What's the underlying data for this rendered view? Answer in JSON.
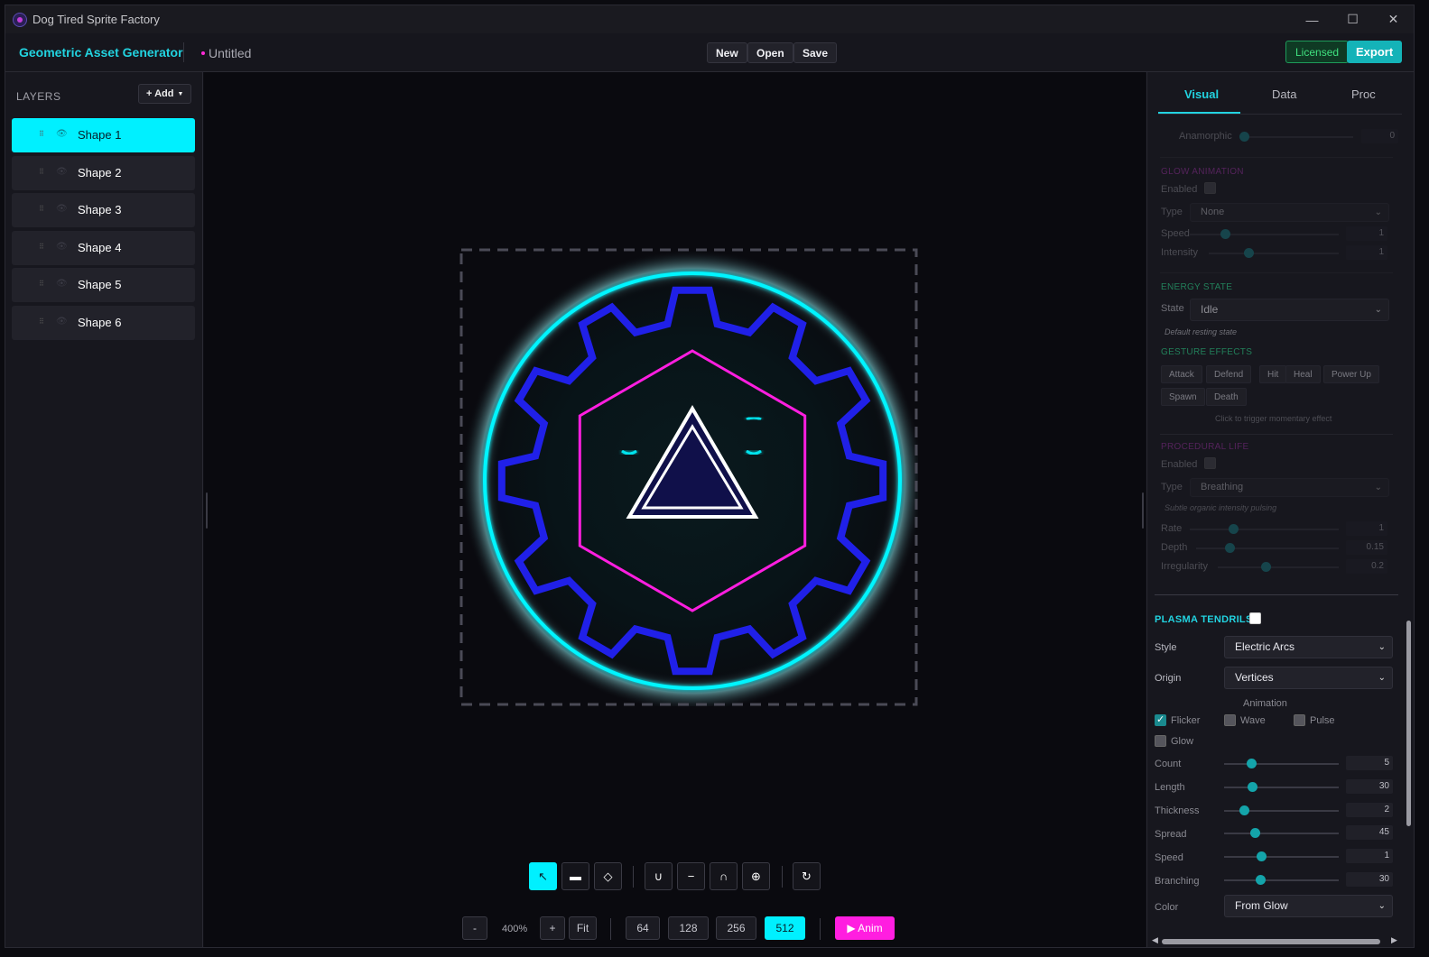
{
  "window": {
    "title": "Dog Tired Sprite Factory"
  },
  "header": {
    "brand": "Geometric Asset Generator",
    "doc_name": "Untitled",
    "new_label": "New",
    "open_label": "Open",
    "save_label": "Save",
    "licensed_label": "Licensed",
    "export_label": "Export"
  },
  "layers": {
    "title": "LAYERS",
    "add_label": "+ Add",
    "items": [
      {
        "label": "Shape 1",
        "active": true
      },
      {
        "label": "Shape 2"
      },
      {
        "label": "Shape 3"
      },
      {
        "label": "Shape 4"
      },
      {
        "label": "Shape 5"
      },
      {
        "label": "Shape 6"
      }
    ]
  },
  "canvas": {
    "colors": {
      "ring": "#00f5ff",
      "gear": "#2020e8",
      "hex": "#ff1ee0",
      "triangle_fill": "#10104a"
    },
    "zoom_minus": "-",
    "zoom_value": "400%",
    "zoom_plus": "+",
    "fit_label": "Fit",
    "sizes": [
      "64",
      "128",
      "256",
      "512"
    ],
    "active_size": "512",
    "anim_label": "▶ Anim"
  },
  "right_panel": {
    "tabs": [
      "Visual",
      "Data",
      "Proc"
    ],
    "active_tab": "Visual",
    "anamorphic": {
      "label": "Anamorphic",
      "value": "0"
    },
    "glow_animation": {
      "title": "GLOW ANIMATION",
      "enabled_label": "Enabled",
      "type_label": "Type",
      "type_value": "None",
      "speed_label": "Speed",
      "speed_value": "1",
      "intensity_label": "Intensity",
      "intensity_value": "1"
    },
    "energy_state": {
      "title": "ENERGY STATE",
      "state_label": "State",
      "state_value": "Idle",
      "hint": "Default resting state"
    },
    "gesture_effects": {
      "title": "GESTURE EFFECTS",
      "buttons": [
        "Attack",
        "Defend",
        "Hit",
        "Heal",
        "Power Up",
        "Spawn",
        "Death"
      ],
      "hint": "Click to trigger momentary effect"
    },
    "procedural_life": {
      "title": "PROCEDURAL LIFE",
      "enabled_label": "Enabled",
      "type_label": "Type",
      "type_value": "Breathing",
      "hint": "Subtle organic intensity pulsing",
      "rate_label": "Rate",
      "rate_value": "1",
      "depth_label": "Depth",
      "depth_value": "0.15",
      "irregularity_label": "Irregularity",
      "irregularity_value": "0.2"
    },
    "plasma_tendrils": {
      "title": "PLASMA TENDRILS",
      "style_label": "Style",
      "style_value": "Electric Arcs",
      "origin_label": "Origin",
      "origin_value": "Vertices",
      "animation_label": "Animation",
      "flicker_label": "Flicker",
      "wave_label": "Wave",
      "pulse_label": "Pulse",
      "glow_label": "Glow",
      "count_label": "Count",
      "count_value": "5",
      "length_label": "Length",
      "length_value": "30",
      "thickness_label": "Thickness",
      "thickness_value": "2",
      "spread_label": "Spread",
      "spread_value": "45",
      "speed_label": "Speed",
      "speed_value": "1",
      "branching_label": "Branching",
      "branching_value": "30",
      "color_label": "Color",
      "color_value": "From Glow"
    }
  }
}
